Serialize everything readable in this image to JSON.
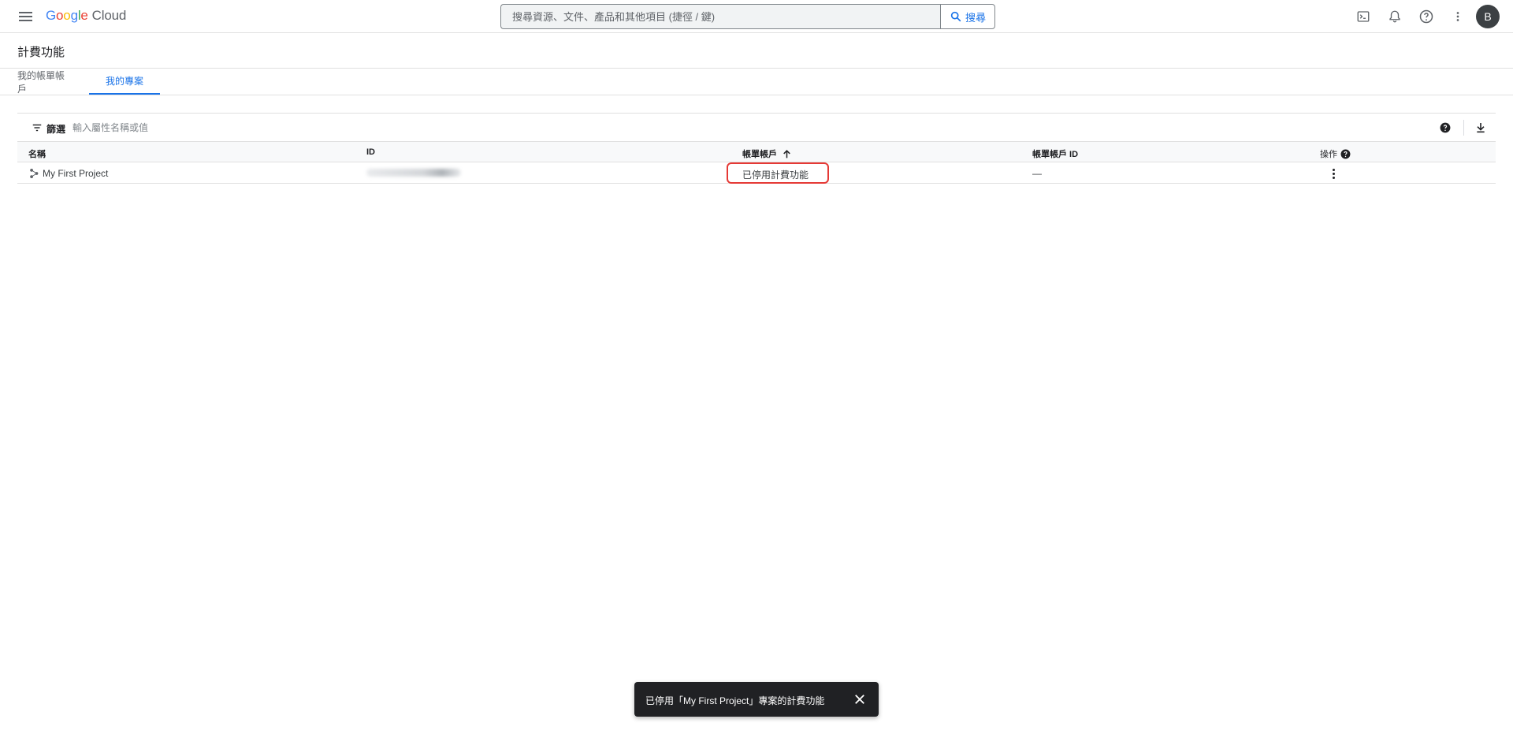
{
  "header": {
    "logo_parts": [
      "G",
      "o",
      "o",
      "g",
      "l",
      "e"
    ],
    "logo_suffix": "Cloud",
    "search_placeholder": "搜尋資源、文件、產品和其他項目 (捷徑 / 鍵)",
    "search_button": "搜尋",
    "avatar_letter": "B",
    "icons": [
      "menu-icon",
      "terminal-icon",
      "bell-icon",
      "help-icon",
      "more-vert-icon"
    ]
  },
  "page": {
    "title": "計費功能"
  },
  "tabs": [
    {
      "label": "我的帳單帳戶",
      "active": false
    },
    {
      "label": "我的專案",
      "active": true
    }
  ],
  "filter": {
    "label": "篩選",
    "placeholder": "輸入屬性名稱或值"
  },
  "table": {
    "columns": [
      "名稱",
      "ID",
      "帳單帳戶",
      "帳單帳戶 ID",
      "操作"
    ],
    "sort": {
      "column": "帳單帳戶",
      "direction": "ascending"
    },
    "rows": [
      {
        "name": "My First Project",
        "id": "",
        "billing_account": "已停用計費功能",
        "billing_account_id": "—"
      }
    ]
  },
  "snackbar": {
    "message": "已停用「My First Project」專案的計費功能"
  },
  "colors": {
    "accent": "#1a73e8",
    "highlight_border": "#e53935",
    "snackbar_bg": "#202124"
  }
}
